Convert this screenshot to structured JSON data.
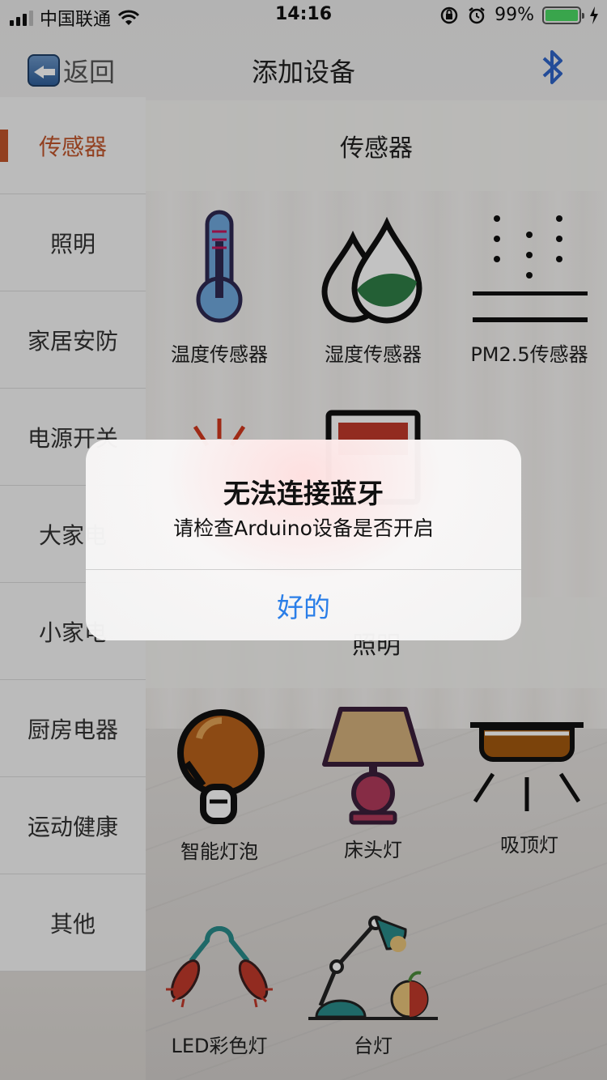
{
  "status_bar": {
    "carrier": "中国联通",
    "time": "14:16",
    "battery": "99%"
  },
  "nav": {
    "back_label": "返回",
    "title": "添加设备"
  },
  "sidebar": {
    "items": [
      {
        "label": "传感器",
        "active": true
      },
      {
        "label": "照明"
      },
      {
        "label": "家居安防"
      },
      {
        "label": "电源开关"
      },
      {
        "label": "大家电"
      },
      {
        "label": "小家电"
      },
      {
        "label": "厨房电器"
      },
      {
        "label": "运动健康"
      },
      {
        "label": "其他"
      }
    ]
  },
  "sections": [
    {
      "title": "传感器",
      "devices": [
        {
          "label": "温度传感器",
          "icon": "thermometer-icon"
        },
        {
          "label": "湿度传感器",
          "icon": "water-drops-icon"
        },
        {
          "label": "PM2.5传感器",
          "icon": "particles-icon"
        },
        {
          "label": "",
          "icon": "sun-icon"
        },
        {
          "label": "",
          "icon": "monitor-icon"
        }
      ]
    },
    {
      "title": "照明",
      "devices": [
        {
          "label": "智能灯泡",
          "icon": "bulb-icon"
        },
        {
          "label": "床头灯",
          "icon": "bedside-lamp-icon"
        },
        {
          "label": "吸顶灯",
          "icon": "ceiling-lamp-icon"
        },
        {
          "label": "LED彩色灯",
          "icon": "led-lights-icon"
        },
        {
          "label": "台灯",
          "icon": "desk-lamp-icon"
        }
      ]
    }
  ],
  "alert": {
    "title": "无法连接蓝牙",
    "message": "请检查Arduino设备是否开启",
    "button": "好的"
  },
  "colors": {
    "accent": "#c0552b",
    "alert_button": "#2a7ee8",
    "bluetooth": "#2f64c8"
  }
}
